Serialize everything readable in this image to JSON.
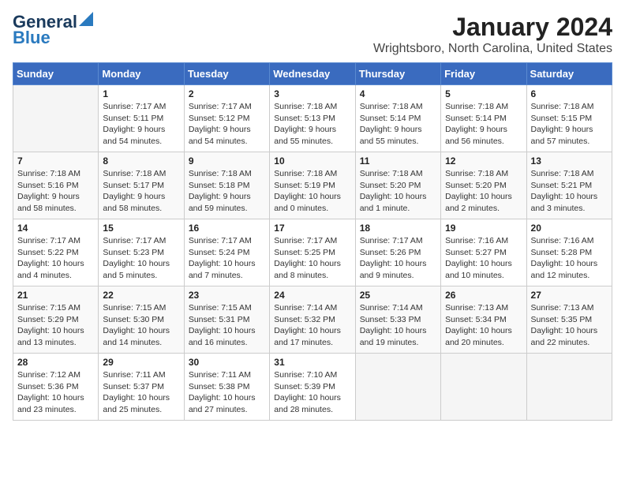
{
  "header": {
    "logo_line1": "General",
    "logo_line2": "Blue",
    "title": "January 2024",
    "subtitle": "Wrightsboro, North Carolina, United States"
  },
  "weekdays": [
    "Sunday",
    "Monday",
    "Tuesday",
    "Wednesday",
    "Thursday",
    "Friday",
    "Saturday"
  ],
  "weeks": [
    [
      {
        "day": "",
        "info": ""
      },
      {
        "day": "1",
        "info": "Sunrise: 7:17 AM\nSunset: 5:11 PM\nDaylight: 9 hours\nand 54 minutes."
      },
      {
        "day": "2",
        "info": "Sunrise: 7:17 AM\nSunset: 5:12 PM\nDaylight: 9 hours\nand 54 minutes."
      },
      {
        "day": "3",
        "info": "Sunrise: 7:18 AM\nSunset: 5:13 PM\nDaylight: 9 hours\nand 55 minutes."
      },
      {
        "day": "4",
        "info": "Sunrise: 7:18 AM\nSunset: 5:14 PM\nDaylight: 9 hours\nand 55 minutes."
      },
      {
        "day": "5",
        "info": "Sunrise: 7:18 AM\nSunset: 5:14 PM\nDaylight: 9 hours\nand 56 minutes."
      },
      {
        "day": "6",
        "info": "Sunrise: 7:18 AM\nSunset: 5:15 PM\nDaylight: 9 hours\nand 57 minutes."
      }
    ],
    [
      {
        "day": "7",
        "info": "Sunrise: 7:18 AM\nSunset: 5:16 PM\nDaylight: 9 hours\nand 58 minutes."
      },
      {
        "day": "8",
        "info": "Sunrise: 7:18 AM\nSunset: 5:17 PM\nDaylight: 9 hours\nand 58 minutes."
      },
      {
        "day": "9",
        "info": "Sunrise: 7:18 AM\nSunset: 5:18 PM\nDaylight: 9 hours\nand 59 minutes."
      },
      {
        "day": "10",
        "info": "Sunrise: 7:18 AM\nSunset: 5:19 PM\nDaylight: 10 hours\nand 0 minutes."
      },
      {
        "day": "11",
        "info": "Sunrise: 7:18 AM\nSunset: 5:20 PM\nDaylight: 10 hours\nand 1 minute."
      },
      {
        "day": "12",
        "info": "Sunrise: 7:18 AM\nSunset: 5:20 PM\nDaylight: 10 hours\nand 2 minutes."
      },
      {
        "day": "13",
        "info": "Sunrise: 7:18 AM\nSunset: 5:21 PM\nDaylight: 10 hours\nand 3 minutes."
      }
    ],
    [
      {
        "day": "14",
        "info": "Sunrise: 7:17 AM\nSunset: 5:22 PM\nDaylight: 10 hours\nand 4 minutes."
      },
      {
        "day": "15",
        "info": "Sunrise: 7:17 AM\nSunset: 5:23 PM\nDaylight: 10 hours\nand 5 minutes."
      },
      {
        "day": "16",
        "info": "Sunrise: 7:17 AM\nSunset: 5:24 PM\nDaylight: 10 hours\nand 7 minutes."
      },
      {
        "day": "17",
        "info": "Sunrise: 7:17 AM\nSunset: 5:25 PM\nDaylight: 10 hours\nand 8 minutes."
      },
      {
        "day": "18",
        "info": "Sunrise: 7:17 AM\nSunset: 5:26 PM\nDaylight: 10 hours\nand 9 minutes."
      },
      {
        "day": "19",
        "info": "Sunrise: 7:16 AM\nSunset: 5:27 PM\nDaylight: 10 hours\nand 10 minutes."
      },
      {
        "day": "20",
        "info": "Sunrise: 7:16 AM\nSunset: 5:28 PM\nDaylight: 10 hours\nand 12 minutes."
      }
    ],
    [
      {
        "day": "21",
        "info": "Sunrise: 7:15 AM\nSunset: 5:29 PM\nDaylight: 10 hours\nand 13 minutes."
      },
      {
        "day": "22",
        "info": "Sunrise: 7:15 AM\nSunset: 5:30 PM\nDaylight: 10 hours\nand 14 minutes."
      },
      {
        "day": "23",
        "info": "Sunrise: 7:15 AM\nSunset: 5:31 PM\nDaylight: 10 hours\nand 16 minutes."
      },
      {
        "day": "24",
        "info": "Sunrise: 7:14 AM\nSunset: 5:32 PM\nDaylight: 10 hours\nand 17 minutes."
      },
      {
        "day": "25",
        "info": "Sunrise: 7:14 AM\nSunset: 5:33 PM\nDaylight: 10 hours\nand 19 minutes."
      },
      {
        "day": "26",
        "info": "Sunrise: 7:13 AM\nSunset: 5:34 PM\nDaylight: 10 hours\nand 20 minutes."
      },
      {
        "day": "27",
        "info": "Sunrise: 7:13 AM\nSunset: 5:35 PM\nDaylight: 10 hours\nand 22 minutes."
      }
    ],
    [
      {
        "day": "28",
        "info": "Sunrise: 7:12 AM\nSunset: 5:36 PM\nDaylight: 10 hours\nand 23 minutes."
      },
      {
        "day": "29",
        "info": "Sunrise: 7:11 AM\nSunset: 5:37 PM\nDaylight: 10 hours\nand 25 minutes."
      },
      {
        "day": "30",
        "info": "Sunrise: 7:11 AM\nSunset: 5:38 PM\nDaylight: 10 hours\nand 27 minutes."
      },
      {
        "day": "31",
        "info": "Sunrise: 7:10 AM\nSunset: 5:39 PM\nDaylight: 10 hours\nand 28 minutes."
      },
      {
        "day": "",
        "info": ""
      },
      {
        "day": "",
        "info": ""
      },
      {
        "day": "",
        "info": ""
      }
    ]
  ]
}
